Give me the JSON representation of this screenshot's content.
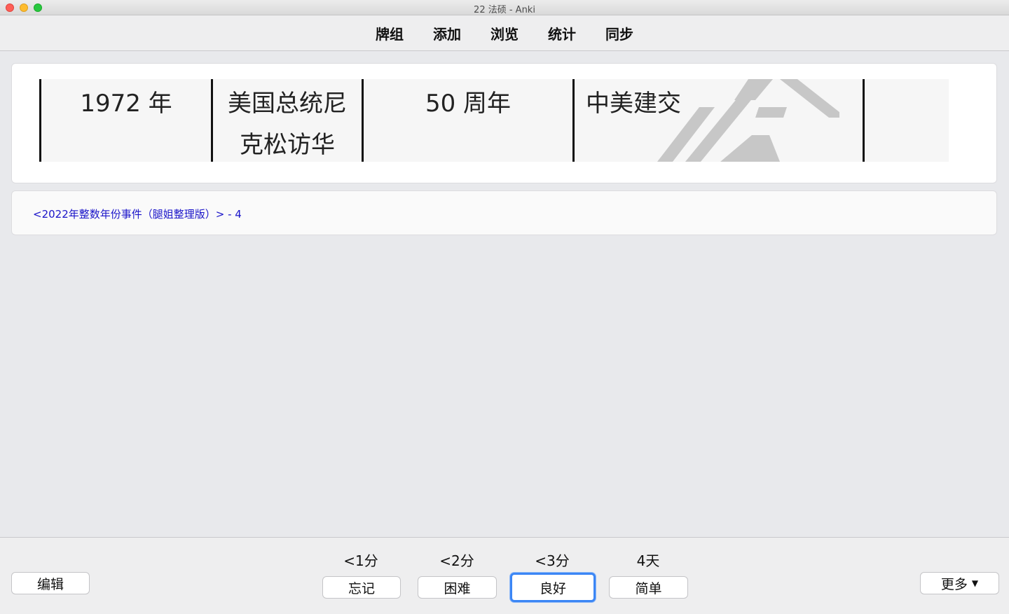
{
  "window": {
    "title": "22 法硕 - Anki"
  },
  "nav": {
    "items": [
      {
        "label": "牌组"
      },
      {
        "label": "添加"
      },
      {
        "label": "浏览"
      },
      {
        "label": "统计"
      },
      {
        "label": "同步"
      }
    ]
  },
  "card": {
    "cells": [
      {
        "text": "1972 年"
      },
      {
        "line1": "美国总统尼",
        "line2": "克松访华"
      },
      {
        "text": "50 周年"
      },
      {
        "text": "中美建交"
      }
    ]
  },
  "deck": {
    "link": "<2022年整数年份事件（腿姐整理版）> - 4"
  },
  "answer": {
    "edit_label": "编辑",
    "more_label": "更多",
    "buttons": [
      {
        "interval": "<1分",
        "label": "忘记"
      },
      {
        "interval": "<2分",
        "label": "困难"
      },
      {
        "interval": "<3分",
        "label": "良好"
      },
      {
        "interval": "4天",
        "label": "简单"
      }
    ]
  },
  "colors": {
    "focus": "#3b86f5",
    "link": "#1a14c9"
  }
}
